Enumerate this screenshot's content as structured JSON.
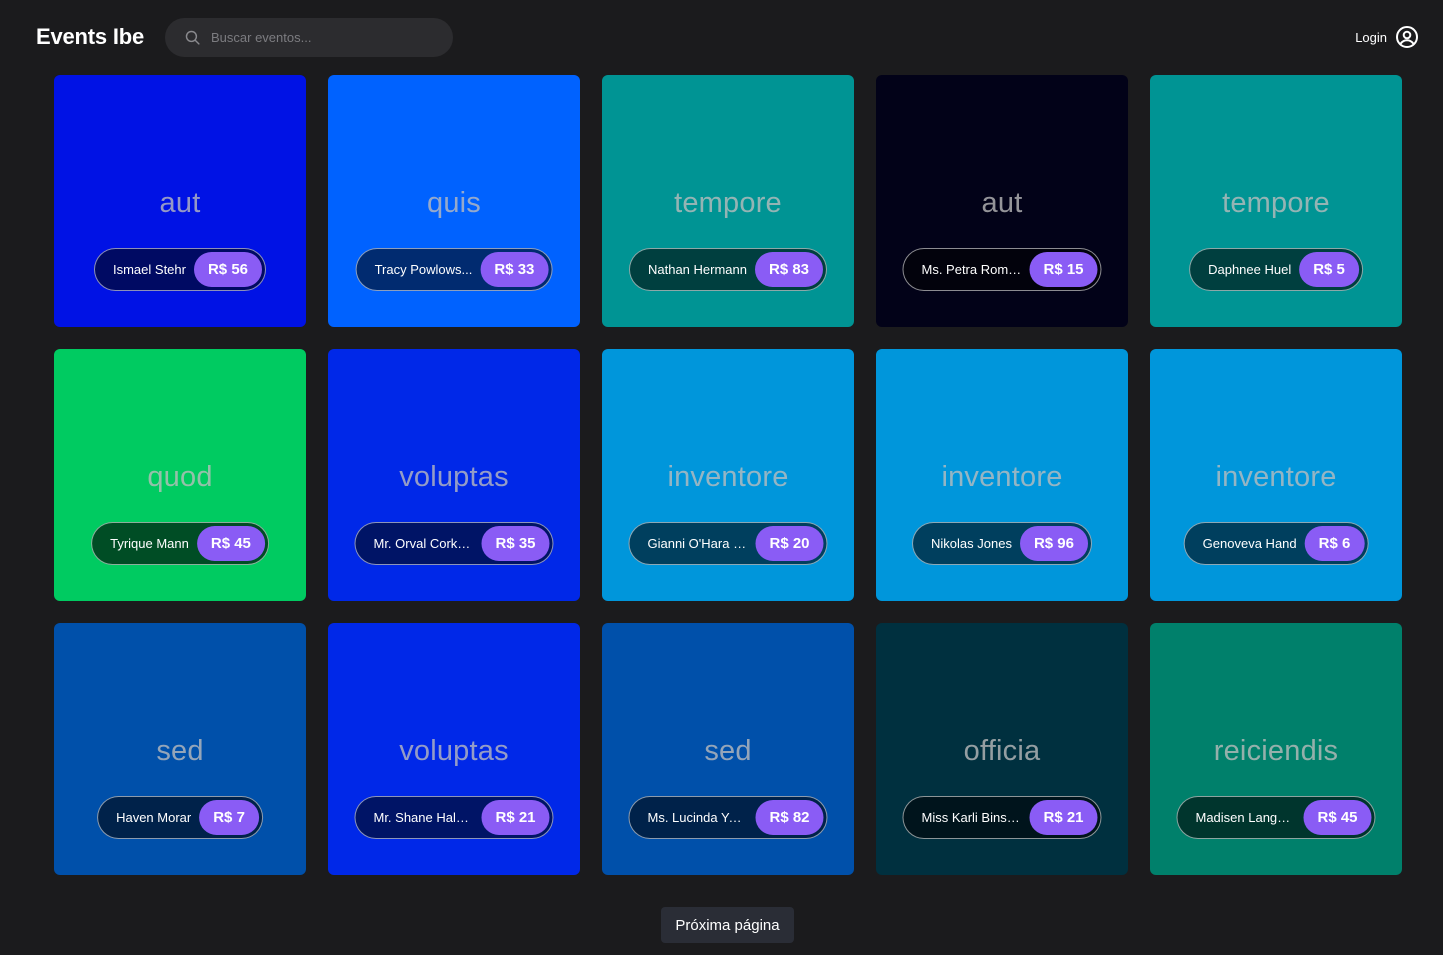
{
  "app": {
    "brand": "Events Ibe"
  },
  "search": {
    "placeholder": "Buscar eventos..."
  },
  "login": {
    "label": "Login"
  },
  "events": [
    {
      "title": "aut",
      "organizer": "Ismael Stehr",
      "price": "R$ 56",
      "bg": "#0012e5",
      "pill_bg": "#000a63"
    },
    {
      "title": "quis",
      "organizer": "Tracy Powlows...",
      "price": "R$ 33",
      "bg": "#0062ff",
      "pill_bg": "#012b70"
    },
    {
      "title": "tempore",
      "organizer": "Nathan Hermann",
      "price": "R$ 83",
      "bg": "#009494",
      "pill_bg": "#003f3f"
    },
    {
      "title": "aut",
      "organizer": "Ms. Petra Roma...",
      "price": "R$ 15",
      "bg": "#020218",
      "pill_bg": "#02020c"
    },
    {
      "title": "tempore",
      "organizer": "Daphnee Huel",
      "price": "R$ 5",
      "bg": "#009494",
      "pill_bg": "#003f3f"
    },
    {
      "title": "quod",
      "organizer": "Tyrique Mann",
      "price": "R$ 45",
      "bg": "#00cb61",
      "pill_bg": "#004d25"
    },
    {
      "title": "voluptas",
      "organizer": "Mr. Orval Corke...",
      "price": "R$ 35",
      "bg": "#0028e8",
      "pill_bg": "#001466"
    },
    {
      "title": "inventore",
      "organizer": "Gianni O'Hara D...",
      "price": "R$ 20",
      "bg": "#0096db",
      "pill_bg": "#003f5e"
    },
    {
      "title": "inventore",
      "organizer": "Nikolas Jones",
      "price": "R$ 96",
      "bg": "#0096db",
      "pill_bg": "#003f5e"
    },
    {
      "title": "inventore",
      "organizer": "Genoveva Hand",
      "price": "R$ 6",
      "bg": "#0096db",
      "pill_bg": "#003f5e"
    },
    {
      "title": "sed",
      "organizer": "Haven Morar",
      "price": "R$ 7",
      "bg": "#0050aa",
      "pill_bg": "#00224a"
    },
    {
      "title": "voluptas",
      "organizer": "Mr. Shane Halvo...",
      "price": "R$ 21",
      "bg": "#0028e8",
      "pill_bg": "#001466"
    },
    {
      "title": "sed",
      "organizer": "Ms. Lucinda Yos...",
      "price": "R$ 82",
      "bg": "#0050aa",
      "pill_bg": "#00224a"
    },
    {
      "title": "officia",
      "organizer": "Miss Karli Bins Jr.",
      "price": "R$ 21",
      "bg": "#00303f",
      "pill_bg": "#00141c"
    },
    {
      "title": "reiciendis",
      "organizer": "Madisen Langw...",
      "price": "R$ 45",
      "bg": "#00806b",
      "pill_bg": "#00352d"
    }
  ],
  "pagination": {
    "next_label": "Próxima página"
  },
  "colors": {
    "background": "#1b1b1d",
    "price_badge": "#8a5cf5",
    "search_bg": "#2c2c2f",
    "next_button_bg": "#2a2d36"
  }
}
